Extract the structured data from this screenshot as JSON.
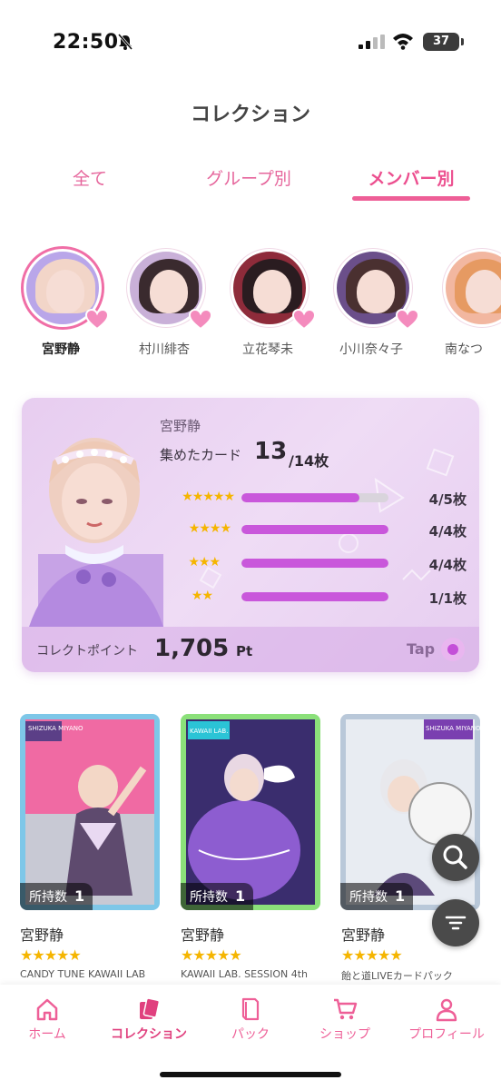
{
  "status_bar": {
    "time": "22:50",
    "battery": "37"
  },
  "header": {
    "title": "コレクション"
  },
  "tabs": [
    {
      "label": "全て",
      "active": false
    },
    {
      "label": "グループ別",
      "active": false
    },
    {
      "label": "メンバー別",
      "active": true
    }
  ],
  "members": [
    {
      "name": "宮野静",
      "selected": true
    },
    {
      "name": "村川緋杏",
      "selected": false
    },
    {
      "name": "立花琴未",
      "selected": false
    },
    {
      "name": "小川奈々子",
      "selected": false
    },
    {
      "name": "南なつ",
      "selected": false
    }
  ],
  "summary": {
    "member_name": "宮野静",
    "collected_label": "集めたカード",
    "collected": "13",
    "total": "/14枚",
    "ratings": [
      {
        "stars": "★★★★★",
        "value": "4/5枚",
        "fill": 0.8
      },
      {
        "stars": "★★★★",
        "value": "4/4枚",
        "fill": 1.0
      },
      {
        "stars": "★★★",
        "value": "4/4枚",
        "fill": 1.0
      },
      {
        "stars": "★★",
        "value": "1/1枚",
        "fill": 1.0
      }
    ],
    "point_label": "コレクトポイント",
    "point_value": "1,705",
    "point_unit": "Pt",
    "tap_label": "Tap"
  },
  "cards": [
    {
      "name": "宮野静",
      "stars": "★★★★★",
      "desc": "CANDY TUNE KAWAII LAB",
      "owned_label": "所持数",
      "owned_count": "1",
      "badge": "SHIZUKA MIYANO"
    },
    {
      "name": "宮野静",
      "stars": "★★★★★",
      "desc": "KAWAII LAB. SESSION 4th",
      "owned_label": "所持数",
      "owned_count": "1",
      "badge": "KAWAII LAB."
    },
    {
      "name": "宮野静",
      "stars": "★★★★★",
      "desc": "飴と道LIVEカードパック",
      "owned_label": "所持数",
      "owned_count": "1",
      "badge": "SHIZUKA MIYANO"
    }
  ],
  "bottom_nav": [
    {
      "label": "ホーム",
      "icon": "home-icon",
      "active": false
    },
    {
      "label": "コレクション",
      "icon": "cards-icon",
      "active": true
    },
    {
      "label": "パック",
      "icon": "pack-icon",
      "active": false
    },
    {
      "label": "ショップ",
      "icon": "cart-icon",
      "active": false
    },
    {
      "label": "プロフィール",
      "icon": "person-icon",
      "active": false
    }
  ],
  "colors": {
    "accent": "#ee5f97",
    "bar_fill": "#c957db",
    "star": "#f5b500"
  }
}
